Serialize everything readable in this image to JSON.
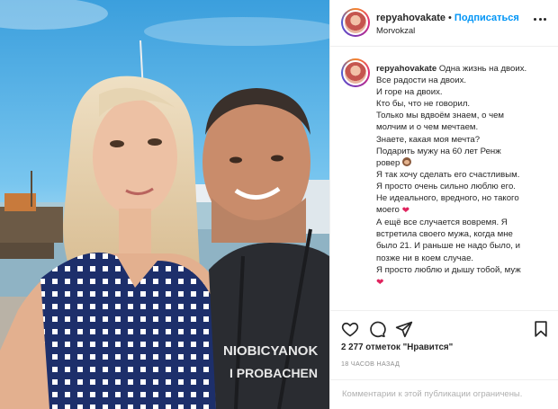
{
  "post": {
    "username": "repyahovakate",
    "follow_label": "Подписаться",
    "location": "Morvokzal",
    "caption_lines": [
      "Одна жизнь на двоих.",
      "Все радости на двоих.",
      "И горе на двоих.",
      "Кто бы, что не говорил.",
      "Только мы вдвоём знаем, о чем",
      "молчим и о чем мечтаем.",
      "Знаете, какая моя мечта?",
      "Подарить мужу на 60 лет Ренж",
      "ровер",
      "Я так хочу сделать его счастливым.",
      "Я просто очень сильно люблю его.",
      "Не идеального, вредного, но такого",
      "моего",
      "А ещё все случается вовремя. Я",
      "встретила своего мужа, когда мне",
      "было 21. И раньше не надо было, и",
      "позже ни в коем случае.",
      "Я просто люблю и дышу тобой, муж"
    ],
    "likes_text": "2 277 отметок \"Нравится\"",
    "time_text": "18 ЧАСОВ НАЗАД",
    "comments_disabled_text": "Комментарии к этой публикации ограничены."
  },
  "photo": {
    "shirt_text_line1": "NIOBICYANOK",
    "shirt_text_line2": "I PROBACHEN"
  },
  "icons": [
    "more-icon",
    "heart-icon",
    "comment-icon",
    "share-icon",
    "bookmark-icon"
  ],
  "colors": {
    "follow": "#0095f6",
    "heart_emoji": "#e0245e",
    "muted": "#8e8e8e"
  }
}
